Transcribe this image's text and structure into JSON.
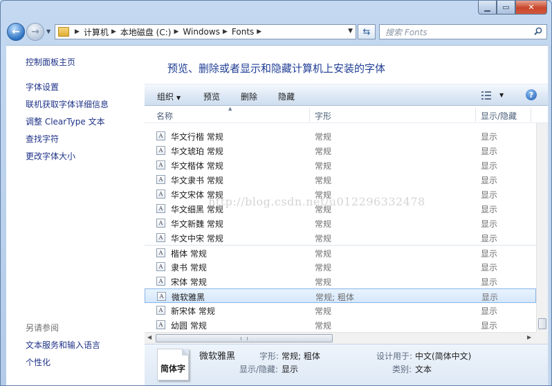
{
  "address": {
    "crumbs": [
      "计算机",
      "本地磁盘 (C:)",
      "Windows",
      "Fonts"
    ]
  },
  "search": {
    "placeholder": "搜索 Fonts"
  },
  "sidebar": {
    "home": "控制面板主页",
    "links": [
      "字体设置",
      "联机获取字体详细信息",
      "调整 ClearType 文本",
      "查找字符",
      "更改字体大小"
    ],
    "see_also_title": "另请参阅",
    "see_also": [
      "文本服务和输入语言",
      "个性化"
    ]
  },
  "main": {
    "heading": "预览、删除或者显示和隐藏计算机上安装的字体"
  },
  "toolbar": {
    "organize": "组织",
    "preview": "预览",
    "delete": "删除",
    "hide": "隐藏",
    "help": "?"
  },
  "columns": {
    "name": "名称",
    "style": "字形",
    "visibility": "显示/隐藏"
  },
  "font_icon_glyph": "A",
  "rows": [
    {
      "name": "华文行楷 常规",
      "style": "常规",
      "visibility": "显示"
    },
    {
      "name": "华文琥珀 常规",
      "style": "常规",
      "visibility": "显示"
    },
    {
      "name": "华文楷体 常规",
      "style": "常规",
      "visibility": "显示"
    },
    {
      "name": "华文隶书 常规",
      "style": "常规",
      "visibility": "显示"
    },
    {
      "name": "华文宋体 常规",
      "style": "常规",
      "visibility": "显示"
    },
    {
      "name": "华文细黑 常规",
      "style": "常规",
      "visibility": "显示"
    },
    {
      "name": "华文新魏 常规",
      "style": "常规",
      "visibility": "显示"
    },
    {
      "name": "华文中宋 常规",
      "style": "常规",
      "visibility": "显示"
    },
    {
      "name": "楷体 常规",
      "style": "常规",
      "visibility": "显示"
    },
    {
      "name": "隶书 常规",
      "style": "常规",
      "visibility": "显示"
    },
    {
      "name": "宋体 常规",
      "style": "常规",
      "visibility": "显示"
    },
    {
      "name": "微软雅黑",
      "style": "常规; 粗体",
      "visibility": "显示"
    },
    {
      "name": "新宋体 常规",
      "style": "常规",
      "visibility": "显示"
    },
    {
      "name": "幼圆 常规",
      "style": "常规",
      "visibility": "显示"
    }
  ],
  "details": {
    "preview_text": "简体字",
    "title": "微软雅黑",
    "style_label": "字形:",
    "style_value": "常规; 粗体",
    "visibility_label": "显示/隐藏:",
    "visibility_value": "显示",
    "designed_for_label": "设计用于:",
    "designed_for_value": "中文(简体中文)",
    "category_label": "类别:",
    "category_value": "文本"
  },
  "watermark": "http://blog.csdn.net/u012296332478"
}
